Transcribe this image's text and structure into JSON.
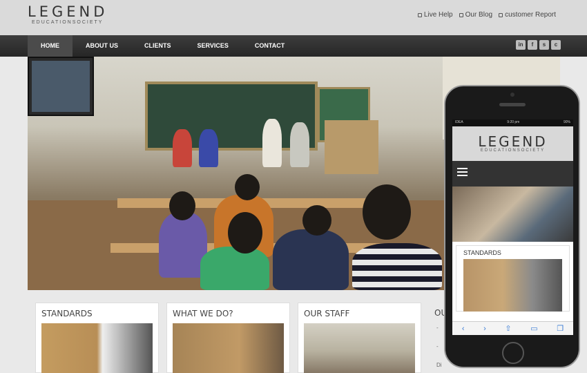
{
  "logo": {
    "title": "LEGEND",
    "subtitle": "EDUCATIONSOCIETY"
  },
  "toplinks": [
    "Live Help",
    "Our Blog",
    "customer Report"
  ],
  "nav": [
    "HOME",
    "ABOUT US",
    "CLIENTS",
    "SERVICES",
    "CONTACT"
  ],
  "social": [
    {
      "name": "linkedin-icon",
      "glyph": "in"
    },
    {
      "name": "facebook-icon",
      "glyph": "f"
    },
    {
      "name": "skype-icon",
      "glyph": "s"
    },
    {
      "name": "chat-icon",
      "glyph": "c"
    }
  ],
  "cards": [
    "STANDARDS",
    "WHAT WE DO?",
    "OUR STAFF"
  ],
  "card4_title": "OU",
  "side_list": [
    "-",
    "-",
    "Di"
  ],
  "mobile": {
    "carrier": "IDEA",
    "time": "9:20 pm",
    "battery": "90%",
    "title": "LEGEND",
    "subtitle": "EDUCATIONSOCIETY",
    "card_title": "STANDARDS",
    "toolbar": [
      "‹",
      "›",
      "⇧",
      "▭",
      "❐"
    ]
  }
}
